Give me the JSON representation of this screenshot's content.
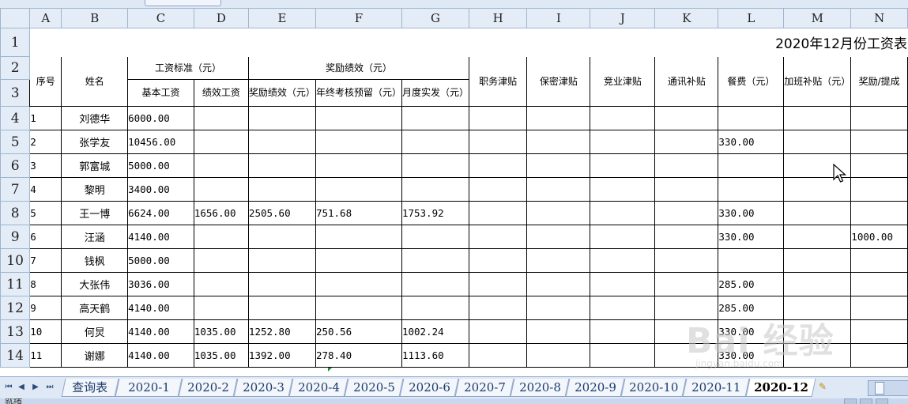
{
  "columns": [
    "A",
    "B",
    "C",
    "D",
    "E",
    "F",
    "G",
    "H",
    "I",
    "J",
    "K",
    "L",
    "M",
    "N"
  ],
  "row_numbers": [
    "1",
    "2",
    "3",
    "4",
    "5",
    "6",
    "7",
    "8",
    "9",
    "10",
    "11",
    "12",
    "13",
    "14"
  ],
  "sheet_title": "2020年12月份工资表",
  "headers": {
    "seq": "序号",
    "name": "姓名",
    "salary_std": "工资标准（元）",
    "bonus_perf": "奖励绩效（元）",
    "base_salary": "基本工资",
    "perf_salary": "绩效工资",
    "bonus_perf_yuan": "奖励绩效（元）",
    "year_end_reserve": "年终考核预留（元）",
    "monthly_actual": "月度实发（元）",
    "duty_allowance": "职务津贴",
    "secrecy_allowance": "保密津贴",
    "noncompete_allowance": "竞业津贴",
    "comm_subsidy": "通讯补贴",
    "meal_fee": "餐费（元）",
    "overtime_subsidy": "加班补贴（元）",
    "reward_commission": "奖励/提成"
  },
  "rows": [
    {
      "seq": "1",
      "name": "刘德华",
      "base": "6000.00",
      "perf": "",
      "bonus": "",
      "reserve": "",
      "actual": "",
      "meal": "",
      "reward": ""
    },
    {
      "seq": "2",
      "name": "张学友",
      "base": "10456.00",
      "perf": "",
      "bonus": "",
      "reserve": "",
      "actual": "",
      "meal": "330.00",
      "reward": ""
    },
    {
      "seq": "3",
      "name": "郭富城",
      "base": "5000.00",
      "perf": "",
      "bonus": "",
      "reserve": "",
      "actual": "",
      "meal": "",
      "reward": ""
    },
    {
      "seq": "4",
      "name": "黎明",
      "base": "3400.00",
      "perf": "",
      "bonus": "",
      "reserve": "",
      "actual": "",
      "meal": "",
      "reward": ""
    },
    {
      "seq": "5",
      "name": "王一博",
      "base": "6624.00",
      "perf": "1656.00",
      "bonus": "2505.60",
      "reserve": "751.68",
      "actual": "1753.92",
      "meal": "330.00",
      "reward": ""
    },
    {
      "seq": "6",
      "name": "汪涵",
      "base": "4140.00",
      "perf": "",
      "bonus": "",
      "reserve": "",
      "actual": "",
      "meal": "330.00",
      "reward": "1000.00"
    },
    {
      "seq": "7",
      "name": "钱枫",
      "base": "5000.00",
      "perf": "",
      "bonus": "",
      "reserve": "",
      "actual": "",
      "meal": "",
      "reward": ""
    },
    {
      "seq": "8",
      "name": "大张伟",
      "base": "3036.00",
      "perf": "",
      "bonus": "",
      "reserve": "",
      "actual": "",
      "meal": "285.00",
      "reward": ""
    },
    {
      "seq": "9",
      "name": "高天鹤",
      "base": "4140.00",
      "perf": "",
      "bonus": "",
      "reserve": "",
      "actual": "",
      "meal": "285.00",
      "reward": ""
    },
    {
      "seq": "10",
      "name": "何炅",
      "base": "4140.00",
      "perf": "1035.00",
      "bonus": "1252.80",
      "reserve": "250.56",
      "actual": "1002.24",
      "meal": "330.00",
      "reward": ""
    },
    {
      "seq": "11",
      "name": "谢娜",
      "base": "4140.00",
      "perf": "1035.00",
      "bonus": "1392.00",
      "reserve": "278.40",
      "actual": "1113.60",
      "meal": "330.00",
      "reward": ""
    }
  ],
  "sheet_tabs": [
    "查询表",
    "2020-1",
    "2020-2",
    "2020-3",
    "2020-4",
    "2020-5",
    "2020-6",
    "2020-7",
    "2020-8",
    "2020-9",
    "2020-10",
    "2020-11",
    "2020-12"
  ],
  "active_tab": "2020-12",
  "status_text": "就绪",
  "watermark": {
    "text": "Bai 经验",
    "sub": "jingyan.baidu.com"
  },
  "colors": {
    "header_bg": "#e4ecf7",
    "grid_line": "#c6d0dc",
    "tab_bar": "#dfe8f5"
  }
}
